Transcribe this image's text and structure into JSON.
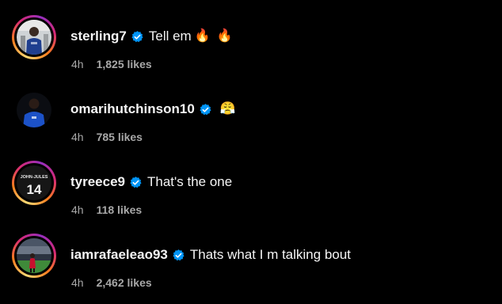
{
  "colors": {
    "background": "#000000",
    "primary_text": "#f5f5f5",
    "secondary_text": "#a8a8a8",
    "verified_blue": "#0095f6"
  },
  "comments": [
    {
      "username": "sterling7",
      "verified": true,
      "text": "Tell em",
      "emojis": [
        "🔥",
        "🔥"
      ],
      "time": "4h",
      "likes": "1,825 likes",
      "avatar_icon": "player-photo-icon",
      "story_ring": true
    },
    {
      "username": "omarihutchinson10",
      "verified": true,
      "text": "",
      "emojis": [
        "😤"
      ],
      "time": "4h",
      "likes": "785 likes",
      "avatar_icon": "player-photo-icon",
      "story_ring": false
    },
    {
      "username": "tyreece9",
      "verified": true,
      "text": "That's the one",
      "emojis": [],
      "time": "4h",
      "likes": "118 likes",
      "avatar_icon": "jersey-icon",
      "avatar_text_top": "JOHN-JULES",
      "avatar_text_number": "14",
      "story_ring": true
    },
    {
      "username": "iamrafaeleao93",
      "verified": true,
      "text": "Thats what I m talking bout",
      "emojis": [],
      "time": "4h",
      "likes": "2,462 likes",
      "avatar_icon": "stadium-photo-icon",
      "story_ring": true
    }
  ]
}
